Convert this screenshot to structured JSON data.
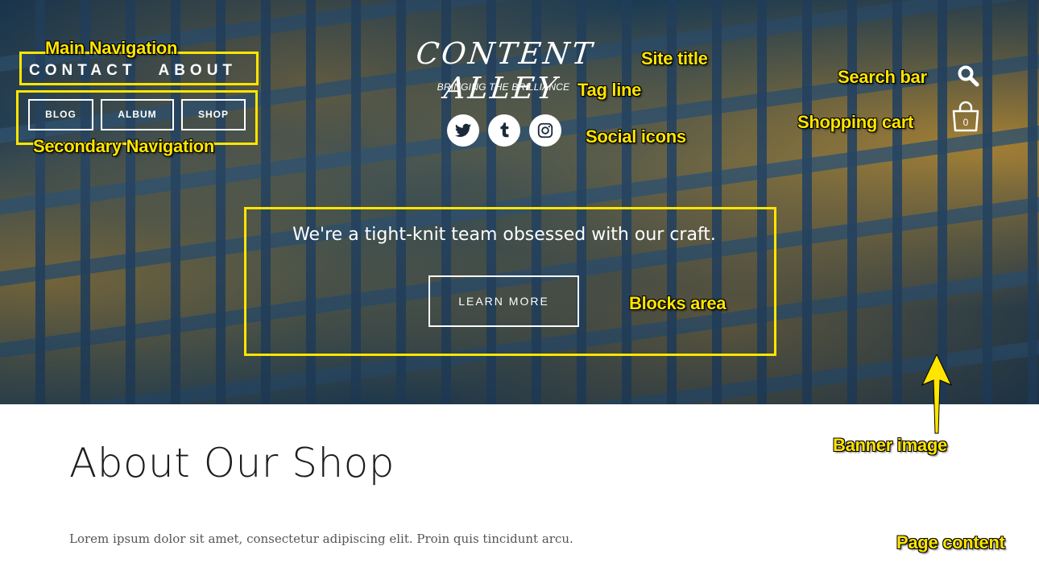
{
  "main_nav": {
    "items": [
      {
        "label": "CONTACT"
      },
      {
        "label": "ABOUT"
      }
    ]
  },
  "secondary_nav": {
    "items": [
      {
        "label": "BLOG"
      },
      {
        "label": "ALBUM"
      },
      {
        "label": "SHOP"
      }
    ]
  },
  "site": {
    "title": "CONTENT ALLEY",
    "tagline": "BRINGING THE BRILLIANCE"
  },
  "social": {
    "icons": [
      "twitter-icon",
      "tumblr-icon",
      "instagram-icon"
    ]
  },
  "cart": {
    "count": "0"
  },
  "block": {
    "text": "We're a tight-knit team obsessed with our craft.",
    "button_label": "LEARN MORE"
  },
  "page": {
    "title": "About Our Shop",
    "body": "Lorem ipsum dolor sit amet, consectetur adipiscing elit. Proin quis tincidunt arcu."
  },
  "annotations": {
    "main_navigation": "Main Navigation",
    "secondary_navigation": "Secondary Navigation",
    "site_title": "Site title",
    "tag_line": "Tag line",
    "social_icons": "Social icons",
    "search_bar": "Search bar",
    "shopping_cart": "Shopping cart",
    "blocks_area": "Blocks area",
    "banner_image": "Banner image",
    "page_content": "Page content"
  },
  "colors": {
    "annotation": "#ffe500",
    "banner_base": "#1d3b55",
    "page_text": "#1d1d1d"
  }
}
